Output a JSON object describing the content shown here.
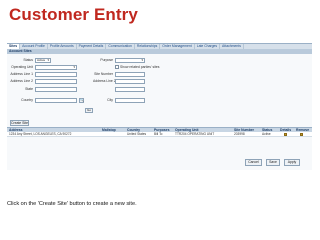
{
  "slide": {
    "title": "Customer Entry",
    "caption": "Click on the 'Create Site' button to create a new site."
  },
  "tabs": [
    {
      "label": "Sites",
      "active": true
    },
    {
      "label": "Account Profile"
    },
    {
      "label": "Profile Amounts"
    },
    {
      "label": "Payment Details"
    },
    {
      "label": "Communication"
    },
    {
      "label": "Relationships"
    },
    {
      "label": "Order Management"
    },
    {
      "label": "Late Charges"
    },
    {
      "label": "Attachments"
    }
  ],
  "section": {
    "title": "Account Sites"
  },
  "form": {
    "status_label": "Status",
    "status_value": "Active",
    "purpose_label": "Purpose",
    "purpose_value": "",
    "operating_unit_label": "Operating Unit",
    "operating_unit_value": "",
    "show_related_label": "Show related parties' sites",
    "address_line1_label": "Address Line 1",
    "site_number_label": "Site Number",
    "address_line2_label": "Address Line 2",
    "state_label": "State",
    "city_label": "City",
    "country_label": "Country",
    "go_button": "Go"
  },
  "create_site_button": "Create Site",
  "table": {
    "headers": {
      "address": "Address",
      "mailstop": "Mailstop",
      "country": "Country",
      "purposes": "Purposes",
      "operating_unit": "Operating Unit",
      "site_number": "Site Number",
      "status": "Status",
      "details": "Details",
      "remove": "Remove"
    },
    "rows": [
      {
        "address": "1234 Any Street, LOS ANGELES, CA 90272",
        "mailstop": "",
        "country": "United States",
        "purposes": "Bill To",
        "operating_unit": "TTR204 OPERATING UNIT",
        "site_number": "203998",
        "status": "Active"
      }
    ]
  },
  "footer": {
    "cancel": "Cancel",
    "save": "Save",
    "apply": "Apply"
  },
  "colors": {
    "title": "#c0281f",
    "tab_bar": "#d6e0ea",
    "section_header": "#b9cadb"
  },
  "icons": [
    "details-icon",
    "remove-icon",
    "dropdown-chevron-icon"
  ]
}
